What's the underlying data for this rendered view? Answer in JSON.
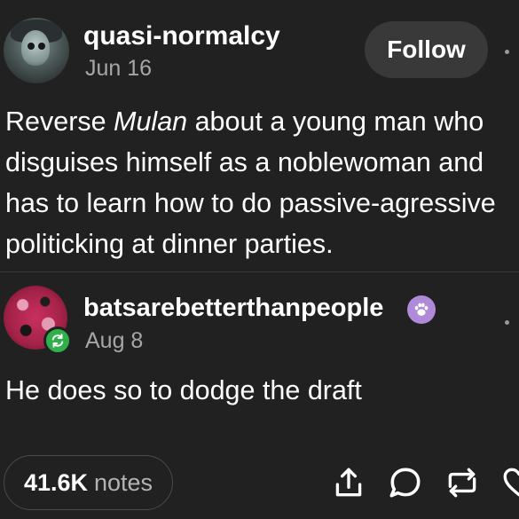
{
  "post": {
    "username": "quasi-normalcy",
    "date": "Jun 16",
    "follow_label": "Follow",
    "body_before": "Reverse ",
    "body_em": "Mulan",
    "body_after": " about a young man who disguises himself as a noblewoman and has to learn how to do passive-agressive politicking at dinner parties."
  },
  "reblog": {
    "username": "batsarebetterthanpeople",
    "date": "Aug 8",
    "body": "He does so to dodge the draft"
  },
  "footer": {
    "notes_count": "41.6K",
    "notes_label": "notes"
  },
  "colors": {
    "background": "#212121",
    "reblog_green": "#2fb04a",
    "badge_purple": "#b08ad9",
    "secondary_text": "#a7a7a7"
  },
  "icons": {
    "share": "share-icon",
    "reply": "reply-icon",
    "reblog": "reblog-icon",
    "like": "heart-icon"
  }
}
